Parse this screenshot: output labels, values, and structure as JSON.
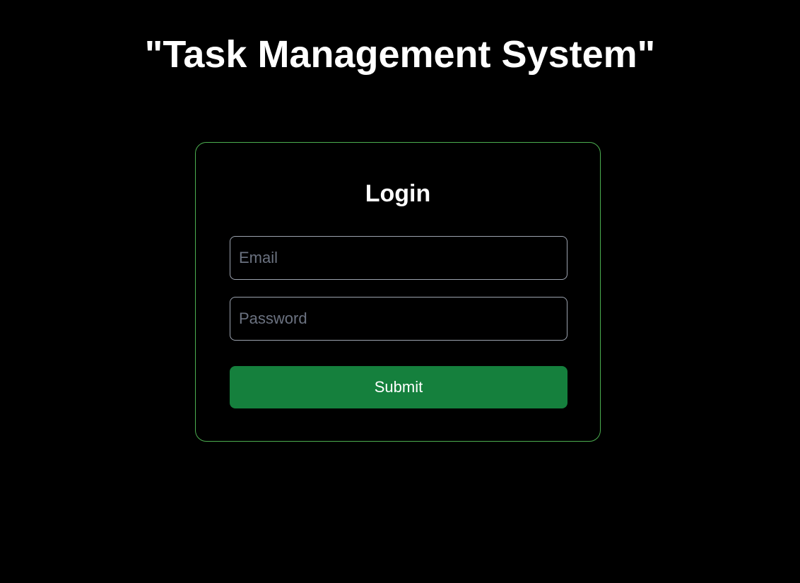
{
  "app": {
    "title": "\"Task Management System\""
  },
  "login": {
    "heading": "Login",
    "email_placeholder": "Email",
    "password_placeholder": "Password",
    "submit_label": "Submit"
  },
  "colors": {
    "background": "#000000",
    "card_border": "#4caf50",
    "submit_button": "#15803d",
    "input_border": "#9ca3af",
    "placeholder": "#6b7280"
  }
}
